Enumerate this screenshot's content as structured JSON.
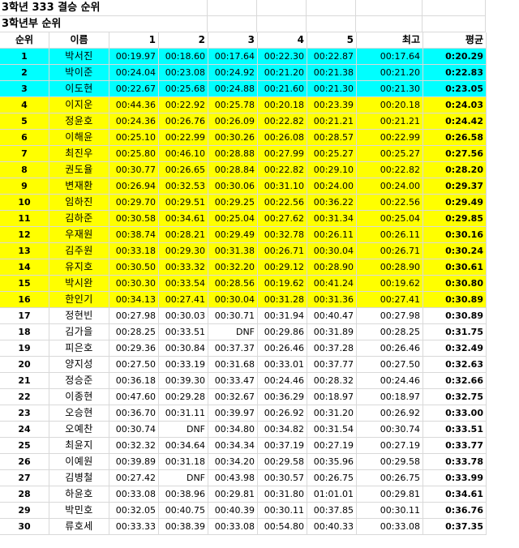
{
  "sheet": {
    "title1": "3학년 333 결승 순위",
    "title2": "3학년부 순위",
    "headers": [
      "순위",
      "이름",
      "1",
      "2",
      "3",
      "4",
      "5",
      "최고",
      "평균"
    ],
    "highlight_colors": {
      "top": "#00ffff",
      "mid": "#ffff00"
    },
    "rows": [
      [
        "1",
        "박서진",
        "00:19.97",
        "00:18.60",
        "00:17.64",
        "00:22.30",
        "00:22.87",
        "00:17.64",
        "0:20.29"
      ],
      [
        "2",
        "박이준",
        "00:24.04",
        "00:23.08",
        "00:24.92",
        "00:21.20",
        "00:21.38",
        "00:21.20",
        "0:22.83"
      ],
      [
        "3",
        "이도현",
        "00:22.67",
        "00:25.68",
        "00:24.88",
        "00:21.60",
        "00:21.30",
        "00:21.30",
        "0:23.05"
      ],
      [
        "4",
        "이지운",
        "00:44.36",
        "00:22.92",
        "00:25.78",
        "00:20.18",
        "00:23.39",
        "00:20.18",
        "0:24.03"
      ],
      [
        "5",
        "정윤호",
        "00:24.36",
        "00:26.76",
        "00:26.09",
        "00:22.82",
        "00:21.21",
        "00:21.21",
        "0:24.42"
      ],
      [
        "6",
        "이해윤",
        "00:25.10",
        "00:22.99",
        "00:30.26",
        "00:26.08",
        "00:28.57",
        "00:22.99",
        "0:26.58"
      ],
      [
        "7",
        "최진우",
        "00:25.80",
        "00:46.10",
        "00:28.88",
        "00:27.99",
        "00:25.27",
        "00:25.27",
        "0:27.56"
      ],
      [
        "8",
        "권도율",
        "00:30.77",
        "00:26.65",
        "00:28.84",
        "00:22.82",
        "00:29.10",
        "00:22.82",
        "0:28.20"
      ],
      [
        "9",
        "변재환",
        "00:26.94",
        "00:32.53",
        "00:30.06",
        "00:31.10",
        "00:24.00",
        "00:24.00",
        "0:29.37"
      ],
      [
        "10",
        "임하진",
        "00:29.70",
        "00:29.51",
        "00:29.25",
        "00:22.56",
        "00:36.22",
        "00:22.56",
        "0:29.49"
      ],
      [
        "11",
        "김하준",
        "00:30.58",
        "00:34.61",
        "00:25.04",
        "00:27.62",
        "00:31.34",
        "00:25.04",
        "0:29.85"
      ],
      [
        "12",
        "우재원",
        "00:38.74",
        "00:28.21",
        "00:29.49",
        "00:32.78",
        "00:26.11",
        "00:26.11",
        "0:30.16"
      ],
      [
        "13",
        "김주원",
        "00:33.18",
        "00:29.30",
        "00:31.38",
        "00:26.71",
        "00:30.04",
        "00:26.71",
        "0:30.24"
      ],
      [
        "14",
        "유지호",
        "00:30.50",
        "00:33.32",
        "00:32.20",
        "00:29.12",
        "00:28.90",
        "00:28.90",
        "0:30.61"
      ],
      [
        "15",
        "박시완",
        "00:30.30",
        "00:33.54",
        "00:28.56",
        "00:19.62",
        "00:41.24",
        "00:19.62",
        "0:30.80"
      ],
      [
        "16",
        "한인기",
        "00:34.13",
        "00:27.41",
        "00:30.04",
        "00:31.28",
        "00:31.36",
        "00:27.41",
        "0:30.89"
      ],
      [
        "17",
        "정현빈",
        "00:27.98",
        "00:30.03",
        "00:30.71",
        "00:31.94",
        "00:40.47",
        "00:27.98",
        "0:30.89"
      ],
      [
        "18",
        "김가을",
        "00:28.25",
        "00:33.51",
        "DNF",
        "00:29.86",
        "00:31.89",
        "00:28.25",
        "0:31.75"
      ],
      [
        "19",
        "피은호",
        "00:29.36",
        "00:30.84",
        "00:37.37",
        "00:26.46",
        "00:37.28",
        "00:26.46",
        "0:32.49"
      ],
      [
        "20",
        "양지성",
        "00:27.50",
        "00:33.19",
        "00:31.68",
        "00:33.01",
        "00:37.77",
        "00:27.50",
        "0:32.63"
      ],
      [
        "21",
        "정승준",
        "00:36.18",
        "00:39.30",
        "00:33.47",
        "00:24.46",
        "00:28.32",
        "00:24.46",
        "0:32.66"
      ],
      [
        "22",
        "이종현",
        "00:47.60",
        "00:29.28",
        "00:32.67",
        "00:36.29",
        "00:18.97",
        "00:18.97",
        "0:32.75"
      ],
      [
        "23",
        "오승현",
        "00:36.70",
        "00:31.11",
        "00:39.97",
        "00:26.92",
        "00:31.20",
        "00:26.92",
        "0:33.00"
      ],
      [
        "24",
        "오예찬",
        "00:30.74",
        "DNF",
        "00:34.80",
        "00:34.82",
        "00:31.54",
        "00:30.74",
        "0:33.51"
      ],
      [
        "25",
        "최윤지",
        "00:32.32",
        "00:34.64",
        "00:34.34",
        "00:37.19",
        "00:27.19",
        "00:27.19",
        "0:33.77"
      ],
      [
        "26",
        "이예원",
        "00:39.89",
        "00:31.18",
        "00:34.20",
        "00:29.58",
        "00:35.96",
        "00:29.58",
        "0:33.78"
      ],
      [
        "27",
        "김병철",
        "00:27.42",
        "DNF",
        "00:43.98",
        "00:30.57",
        "00:26.75",
        "00:26.75",
        "0:33.99"
      ],
      [
        "28",
        "하윤호",
        "00:33.08",
        "00:38.96",
        "00:29.81",
        "00:31.80",
        "01:01.01",
        "00:29.81",
        "0:34.61"
      ],
      [
        "29",
        "박민호",
        "00:32.05",
        "00:40.75",
        "00:40.39",
        "00:30.11",
        "00:37.85",
        "00:30.11",
        "0:36.76"
      ],
      [
        "30",
        "류호세",
        "00:33.33",
        "00:38.39",
        "00:33.08",
        "00:54.80",
        "00:40.33",
        "00:33.08",
        "0:37.35"
      ]
    ]
  }
}
